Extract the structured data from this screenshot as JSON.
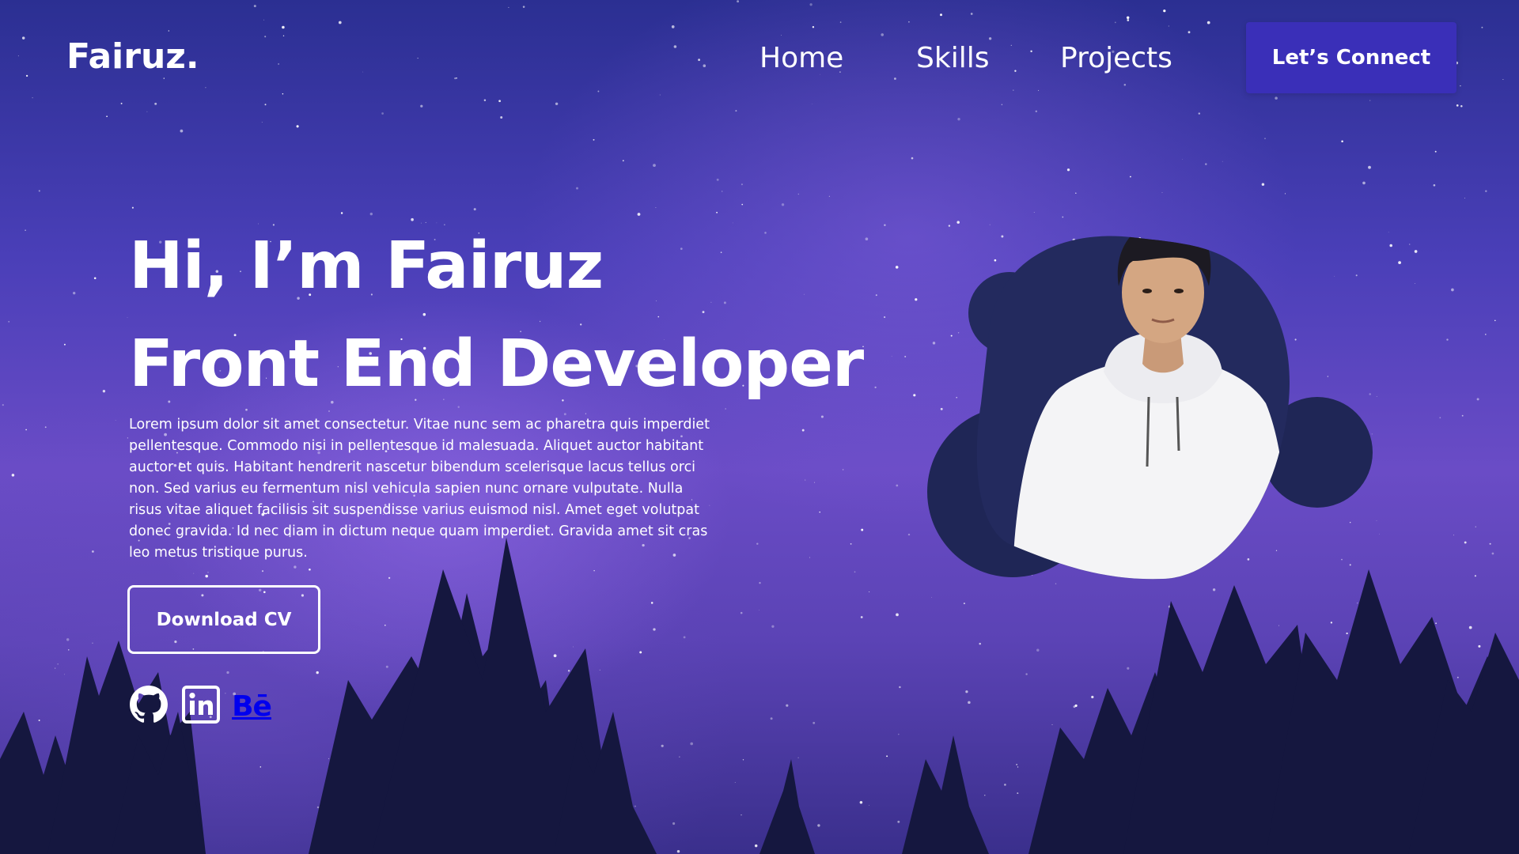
{
  "header": {
    "logo": "Fairuz.",
    "nav": [
      {
        "label": "Home"
      },
      {
        "label": "Skills"
      },
      {
        "label": "Projects"
      }
    ],
    "cta_label": "Let’s Connect"
  },
  "hero": {
    "greeting": "Hi, I’m Fairuz",
    "role": "Front End Developer",
    "bio": "Lorem ipsum dolor sit amet consectetur. Vitae nunc sem ac pharetra quis imperdiet pellentesque. Commodo nisi in pellentesque id malesuada. Aliquet auctor habitant auctor et quis. Habitant hendrerit nascetur bibendum scelerisque lacus tellus orci non. Sed varius eu fermentum nisl vehicula sapien nunc ornare vulputate. Nulla risus vitae aliquet facilisis sit suspendisse varius euismod nisl. Amet eget volutpat donec gravida. Id nec diam in dictum neque quam imperdiet. Gravida amet sit cras leo metus tristique purus.",
    "download_label": "Download CV"
  },
  "socials": [
    {
      "icon": "github-icon"
    },
    {
      "icon": "linkedin-icon"
    },
    {
      "icon": "behance-icon",
      "glyph": "Bē"
    }
  ],
  "colors": {
    "accent": "#3a2fb8",
    "blob": "#232a5e",
    "blob_dark": "#1d2252",
    "tree": "#14163f"
  }
}
